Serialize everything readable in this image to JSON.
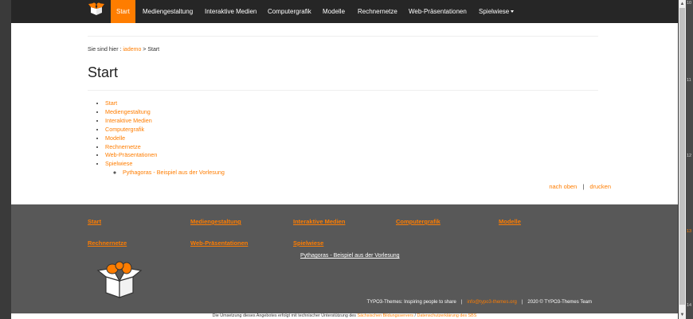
{
  "nav": {
    "items": [
      {
        "label": "Start",
        "active": true
      },
      {
        "label": "Mediengestaltung"
      },
      {
        "label": "Interaktive Medien"
      },
      {
        "label": "Computergrafik"
      },
      {
        "label": "Modelle"
      },
      {
        "label": "Rechnernetze"
      },
      {
        "label": "Web-Präsentationen"
      },
      {
        "label": "Spielwiese",
        "dropdown": true
      }
    ]
  },
  "breadcrumb": {
    "prefix": "Sie sind hier :",
    "home": "iademo",
    "separator": ">",
    "current": "Start"
  },
  "page": {
    "title": "Start"
  },
  "sitemap": {
    "items": [
      "Start",
      "Mediengestaltung",
      "Interaktive Medien",
      "Computergrafik",
      "Modelle",
      "Rechnernetze",
      "Web-Präsentationen",
      "Spielwiese"
    ],
    "subitems": [
      "Pythagoras - Beispiel aus der Vorlesung"
    ]
  },
  "tools": {
    "top": "nach oben",
    "separator": "|",
    "print": "drucken"
  },
  "footer": {
    "links": [
      "Start",
      "Mediengestaltung",
      "Interaktive Medien",
      "Computergrafik",
      "Modelle",
      "Rechnernetze",
      "Web-Präsentationen",
      "Spielwiese"
    ],
    "sub_link": "Pythagoras - Beispiel aus der Vorlesung",
    "tagline": "TYPO3-Themes: Inspiring people to share",
    "separator": "|",
    "email": "info@typo3-themes.org",
    "copyright": "2020 © TYPO3-Themes Team"
  },
  "bottom_bar": {
    "text": "Die Umsetzung dieses Angebotes erfolgt mit technischer Unterstützung des",
    "link1": "Sächsischen Bildungsservers",
    "separator": "/",
    "link2": "Datenschutzerklärung des SBS"
  },
  "ruler": {
    "labels": [
      "10",
      "11",
      "12",
      "13",
      "14"
    ]
  },
  "colors": {
    "accent": "#ff7d00",
    "navbar": "#262626",
    "footer": "#585858",
    "content": "#ffffff"
  }
}
